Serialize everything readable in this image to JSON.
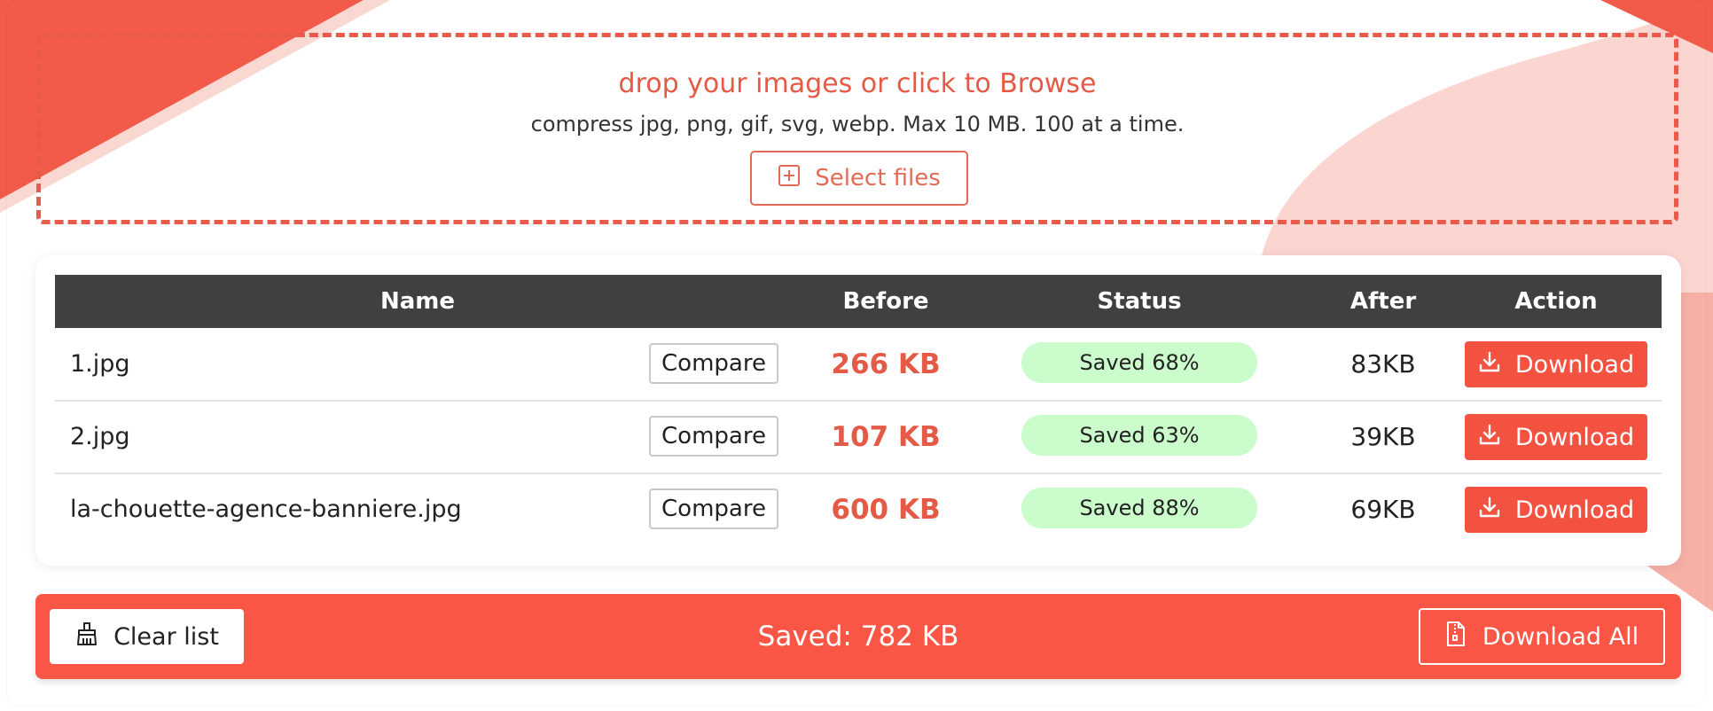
{
  "colors": {
    "accent": "#f35240",
    "accent_text": "#e55a45",
    "header_bg": "#404040",
    "status_bg": "#cbfccb"
  },
  "dropzone": {
    "title": "drop your images or click to Browse",
    "subtitle": "compress jpg, png, gif, svg, webp. Max 10 MB. 100 at a time.",
    "select_label": "Select files",
    "select_icon": "plus-square-icon"
  },
  "table": {
    "headers": {
      "name": "Name",
      "before": "Before",
      "status": "Status",
      "after": "After",
      "action": "Action"
    },
    "rows": [
      {
        "name": "1.jpg",
        "compare": "Compare",
        "before": "266 KB",
        "status": "Saved 68%",
        "after": "83KB",
        "action": "Download"
      },
      {
        "name": "2.jpg",
        "compare": "Compare",
        "before": "107 KB",
        "status": "Saved 63%",
        "after": "39KB",
        "action": "Download"
      },
      {
        "name": "la-chouette-agence-banniere.jpg",
        "compare": "Compare",
        "before": "600 KB",
        "status": "Saved 88%",
        "after": "69KB",
        "action": "Download"
      }
    ]
  },
  "footer": {
    "clear_label": "Clear list",
    "clear_icon": "broom-icon",
    "saved_total": "Saved: 782 KB",
    "download_all_label": "Download All",
    "download_all_icon": "zip-file-icon"
  }
}
